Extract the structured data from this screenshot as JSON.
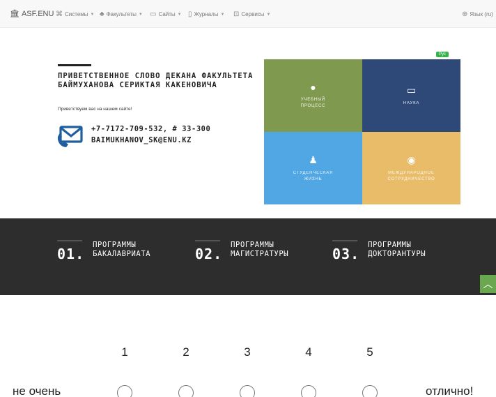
{
  "nav": {
    "brand": "ASF.ENU",
    "items": [
      {
        "label": "Системы",
        "icon": "sitemap-icon"
      },
      {
        "label": "Факультеты",
        "icon": "org-chart-icon"
      },
      {
        "label": "Сайты",
        "icon": "window-icon"
      },
      {
        "label": "Журналы",
        "icon": "book-icon"
      },
      {
        "label": "Сервисы",
        "icon": "services-icon"
      }
    ],
    "language": "Язык (ru)"
  },
  "intro": {
    "title": "ПРИВЕТСТВЕННОЕ СЛОВО ДЕКАНА ФАКУЛЬТЕТА БАЙМУХАНОВА СЕРИКТАЯ КАКЕНОВИЧА",
    "greeting": "Приветствуем вас на нашем сайте!",
    "phone": "+7-7172-709-532, # 33-300",
    "email": "BAIMUKHANOV_SK@ENU.KZ"
  },
  "lang_badge": "Рус",
  "tiles": [
    {
      "label": "УЧЕБНЫЙ\nПРОЦЕСС",
      "color": "#7f9a4f",
      "icon": "lightbulb-icon"
    },
    {
      "label": "НАУКА",
      "color": "#2e4878",
      "icon": "monitor-icon"
    },
    {
      "label": "СТУДЕНЧЕСКАЯ\nЖИЗНЬ",
      "color": "#51a6e4",
      "icon": "users-icon"
    },
    {
      "label": "МЕЖДУНАРОДНОЕ\nСОТРУДНИЧЕСТВО",
      "color": "#e8bc69",
      "icon": "globe-icon"
    }
  ],
  "programs": [
    {
      "num": "01.",
      "label": "ПРОГРАММЫ\nБАКАЛАВРИАТА"
    },
    {
      "num": "02.",
      "label": "ПРОГРАММЫ\nМАГИСТРАТУРЫ"
    },
    {
      "num": "03.",
      "label": "ПРОГРАММЫ\nДОКТОРАНТУРЫ"
    }
  ],
  "rating": {
    "scale": [
      "1",
      "2",
      "3",
      "4",
      "5"
    ],
    "low_label": "не очень",
    "high_label": "отлично!"
  }
}
